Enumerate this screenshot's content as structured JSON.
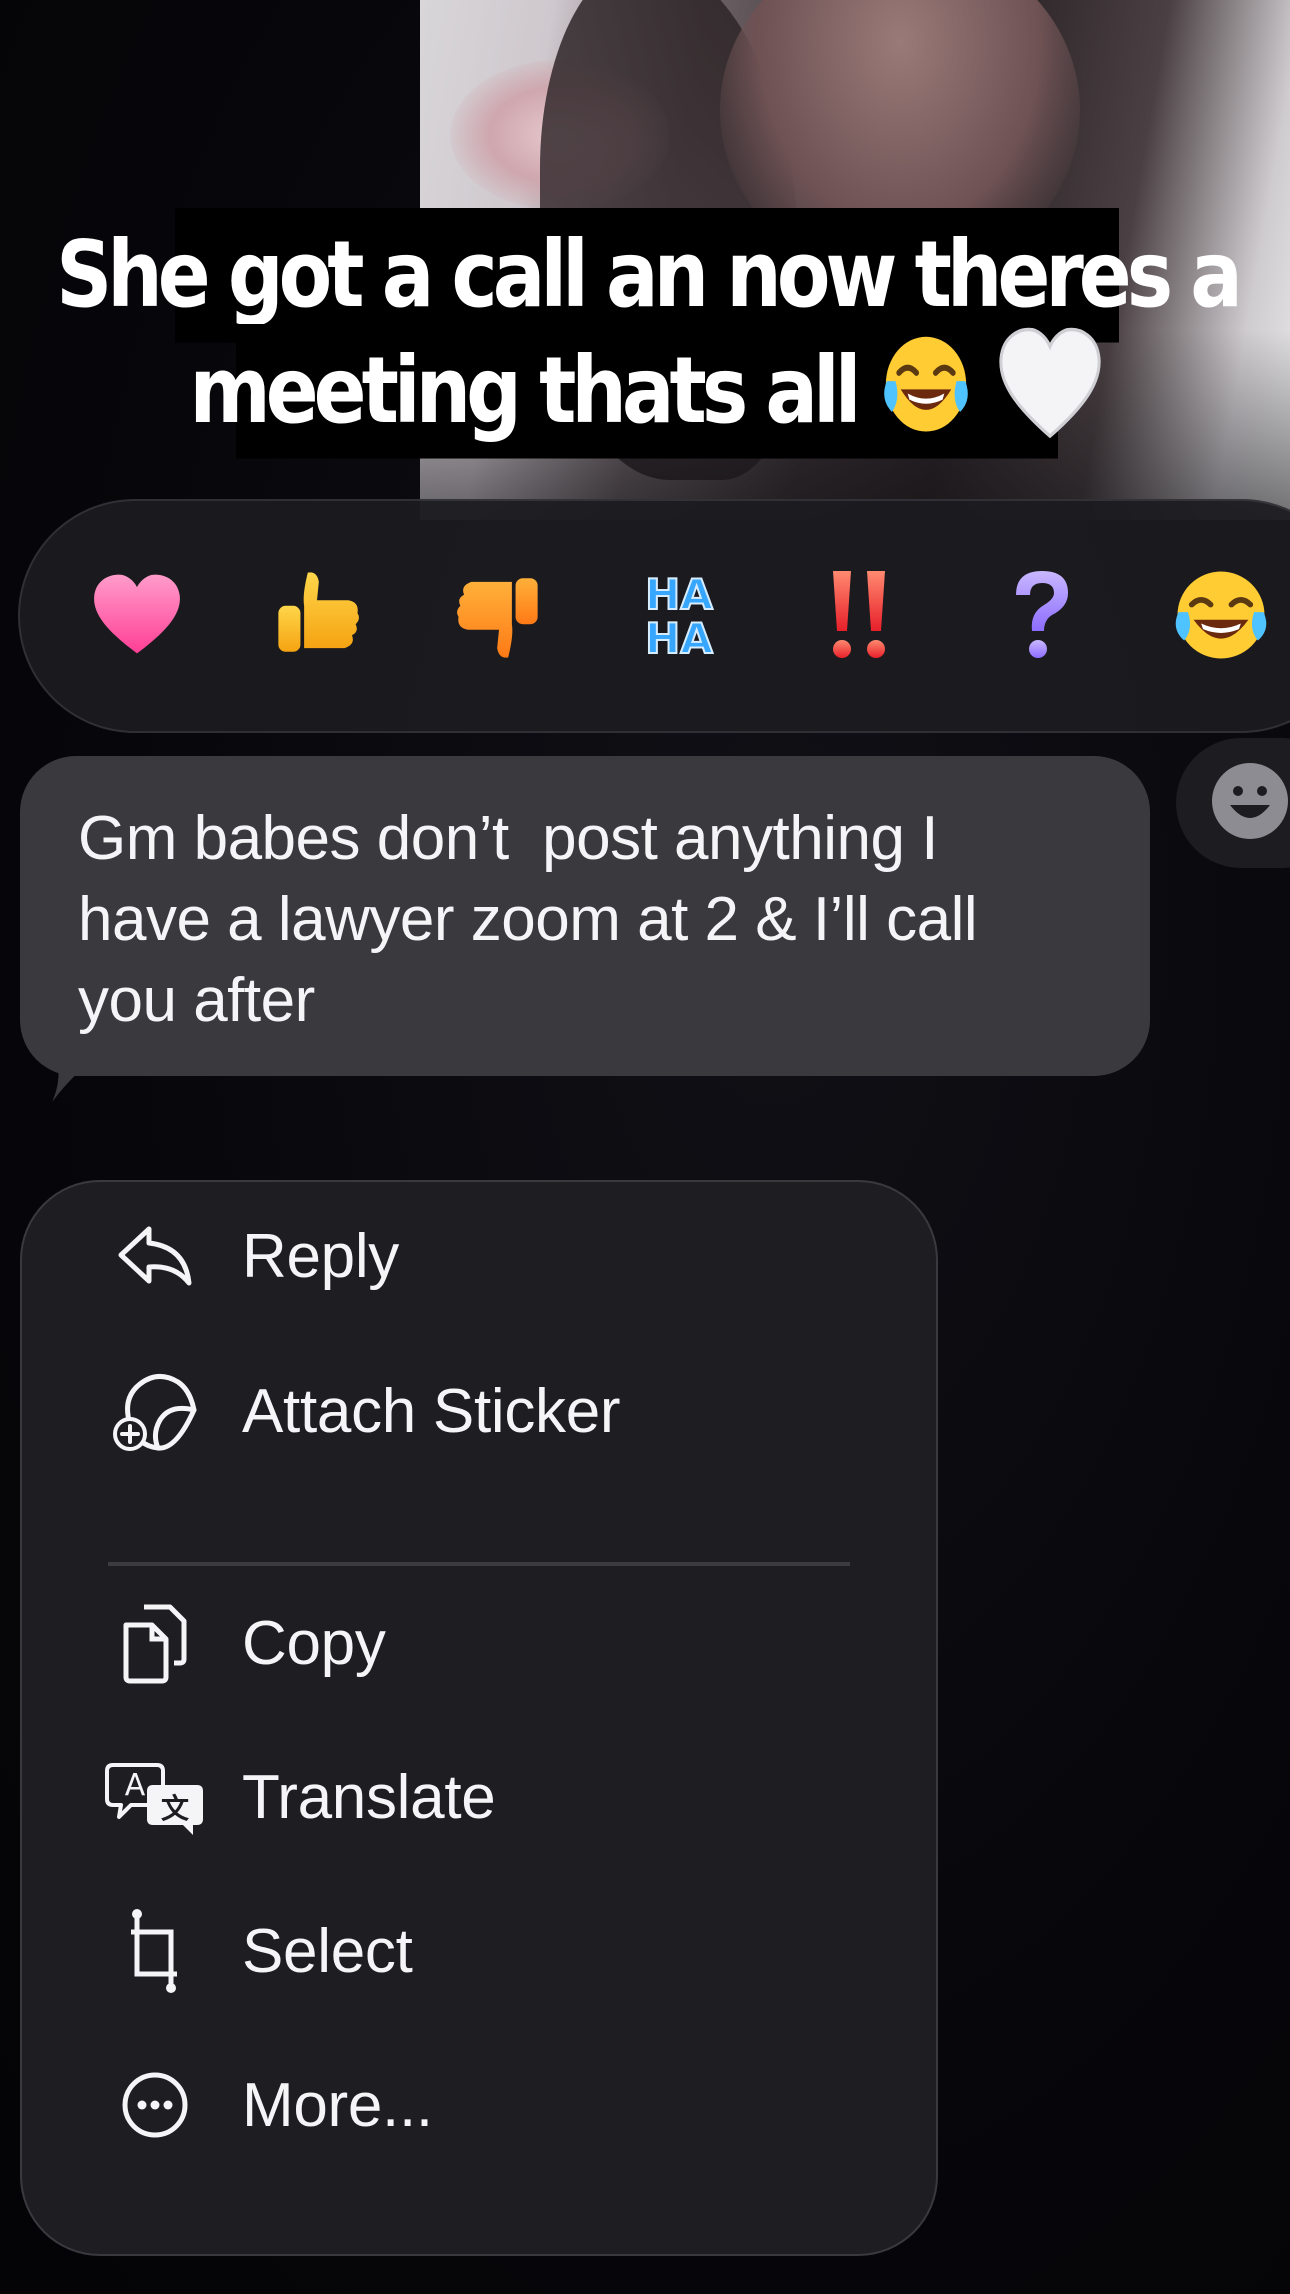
{
  "caption": {
    "line1": "She got a call an now theres a",
    "line2": "meeting thats all",
    "line2_emojis": [
      "face-with-tears-of-joy",
      "white-heart"
    ]
  },
  "tapbacks": [
    {
      "name": "heart",
      "color": "#ff5fa8"
    },
    {
      "name": "thumbs-up",
      "color": "#ffc22d"
    },
    {
      "name": "thumbs-down",
      "color": "#ff9a1f"
    },
    {
      "name": "haha",
      "label_top": "HA",
      "label_bottom": "HA",
      "color": "#2f9cff"
    },
    {
      "name": "emphasize",
      "label": "!!",
      "color": "#ff4a4a"
    },
    {
      "name": "question",
      "label": "?",
      "color": "#a58cff"
    },
    {
      "name": "laughing",
      "color": "#ffcf2d"
    }
  ],
  "emoji_picker": {
    "icon": "smiley-face-icon"
  },
  "message": {
    "text": "Gm babes don’t  post anything I\nhave a lawyer zoom at 2 & I’ll call\nyou after",
    "bubble_color": "#3a3a3e"
  },
  "menu": {
    "items_group1": [
      {
        "label": "Reply",
        "icon": "reply-icon"
      },
      {
        "label": "Attach Sticker",
        "icon": "sticker-icon"
      }
    ],
    "items_group2": [
      {
        "label": "Copy",
        "icon": "copy-icon"
      },
      {
        "label": "Translate",
        "icon": "translate-icon"
      },
      {
        "label": "Select",
        "icon": "select-crop-icon"
      },
      {
        "label": "More...",
        "icon": "more-icon"
      }
    ]
  }
}
